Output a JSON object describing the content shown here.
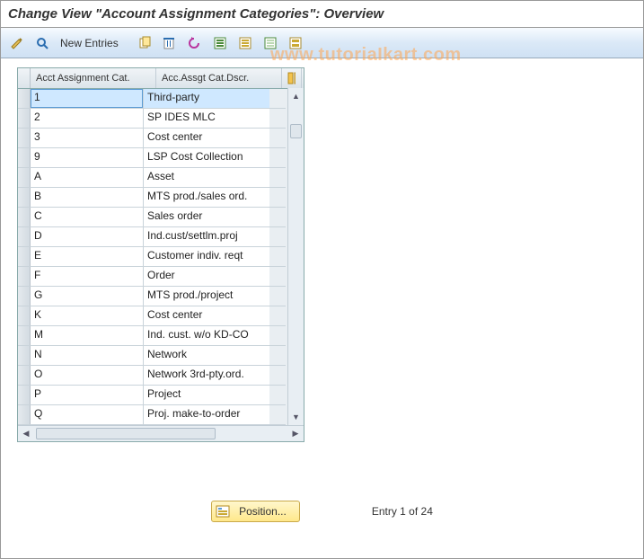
{
  "title": "Change View \"Account Assignment Categories\": Overview",
  "toolbar": {
    "new_entries": "New Entries"
  },
  "watermark": "www.tutoriaIkart.com",
  "table": {
    "col1": "Acct Assignment Cat.",
    "col2": "Acc.Assgt Cat.Dscr.",
    "rows": [
      {
        "cat": "1",
        "desc": "Third-party",
        "sel": true
      },
      {
        "cat": "2",
        "desc": "SP IDES MLC"
      },
      {
        "cat": "3",
        "desc": "Cost center"
      },
      {
        "cat": "9",
        "desc": "LSP Cost Collection"
      },
      {
        "cat": "A",
        "desc": "Asset"
      },
      {
        "cat": "B",
        "desc": "MTS prod./sales ord."
      },
      {
        "cat": "C",
        "desc": "Sales order"
      },
      {
        "cat": "D",
        "desc": "Ind.cust/settlm.proj"
      },
      {
        "cat": "E",
        "desc": "Customer indiv. reqt"
      },
      {
        "cat": "F",
        "desc": "Order"
      },
      {
        "cat": "G",
        "desc": "MTS prod./project"
      },
      {
        "cat": "K",
        "desc": "Cost center"
      },
      {
        "cat": "M",
        "desc": "Ind. cust. w/o KD-CO"
      },
      {
        "cat": "N",
        "desc": "Network"
      },
      {
        "cat": "O",
        "desc": "Network 3rd-pty.ord."
      },
      {
        "cat": "P",
        "desc": "Project"
      },
      {
        "cat": "Q",
        "desc": "Proj. make-to-order"
      }
    ]
  },
  "footer": {
    "position": "Position...",
    "entry": "Entry 1 of 24"
  }
}
